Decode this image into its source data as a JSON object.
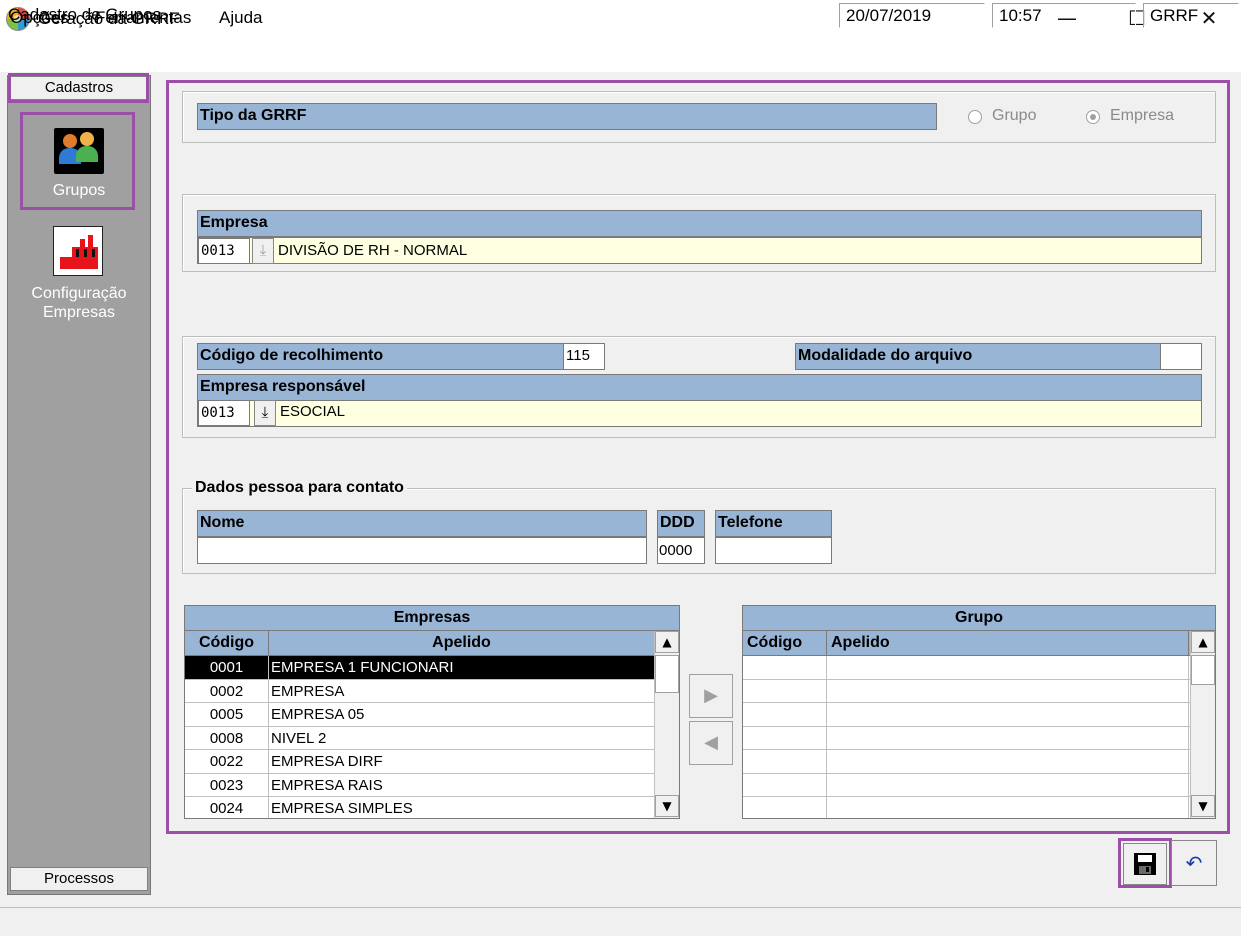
{
  "window": {
    "title": "Geração da GRRF",
    "minimize": "—",
    "maximize": "☐",
    "close": "✕"
  },
  "menu": [
    "Opções",
    "Ferramentas",
    "Ajuda"
  ],
  "sidebar": {
    "top_tab": "Cadastros",
    "items": [
      {
        "label": "Grupos",
        "icon": "users-group-icon"
      },
      {
        "label": "Configuração Empresas",
        "icon": "factory-icon"
      }
    ],
    "bottom_tab": "Processos"
  },
  "tipo": {
    "label": "Tipo da GRRF",
    "options": [
      {
        "label": "Grupo",
        "checked": false
      },
      {
        "label": "Empresa",
        "checked": true
      }
    ]
  },
  "empresa": {
    "label": "Empresa",
    "code": "0013",
    "name": "DIVISÃO DE RH - NORMAL"
  },
  "recolhimento": {
    "codigo_label": "Código de recolhimento",
    "codigo_value": "115",
    "modalidade_label": "Modalidade do arquivo",
    "modalidade_value": "",
    "responsavel_label": "Empresa responsável",
    "responsavel_code": "0013",
    "responsavel_name": "ESOCIAL"
  },
  "contato": {
    "legend": "Dados pessoa para contato",
    "nome_label": "Nome",
    "nome_value": "",
    "ddd_label": "DDD",
    "ddd_value": "0000",
    "telefone_label": "Telefone",
    "telefone_value": ""
  },
  "empresas_table": {
    "title": "Empresas",
    "columns": [
      "Código",
      "Apelido"
    ],
    "rows": [
      [
        "0001",
        "EMPRESA 1 FUNCIONARI"
      ],
      [
        "0002",
        "EMPRESA"
      ],
      [
        "0005",
        "EMPRESA 05"
      ],
      [
        "0008",
        "NIVEL 2"
      ],
      [
        "0022",
        "EMPRESA DIRF"
      ],
      [
        "0023",
        "EMPRESA RAIS"
      ],
      [
        "0024",
        "EMPRESA SIMPLES"
      ]
    ],
    "selected_row": 0
  },
  "grupo_table": {
    "title": "Grupo",
    "columns": [
      "Código",
      "Apelido"
    ],
    "rows": []
  },
  "status": {
    "message": "Cadastro de Grupos",
    "date": "20/07/2019",
    "time": "10:57",
    "module": "GRRF"
  }
}
